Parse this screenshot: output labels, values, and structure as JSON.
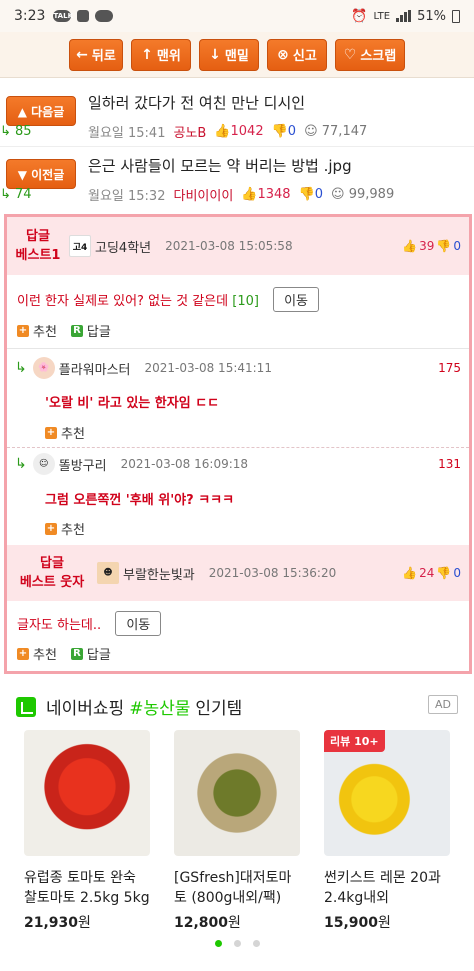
{
  "status": {
    "time": "3:23",
    "network": "LTE",
    "battery": "51%"
  },
  "toolbar": {
    "buttons": [
      {
        "icon": "←",
        "label": "뒤로"
      },
      {
        "icon": "↑",
        "label": "맨위"
      },
      {
        "icon": "↓",
        "label": "맨밑"
      },
      {
        "icon": "⊗",
        "label": "신고"
      },
      {
        "icon": "♡",
        "label": "스크랩"
      }
    ]
  },
  "nav": {
    "next": {
      "button": "▲ 다음글",
      "title": "일하러 갔다가 전 여친 만난 디시인",
      "date": "월요일 15:41",
      "author": "공노B",
      "up": "1042",
      "down": "0",
      "replies": "85",
      "views": "77,147"
    },
    "prev": {
      "button": "▼ 이전글",
      "title": "은근 사람들이 모르는 약 버리는 방법 .jpg",
      "date": "월요일 15:32",
      "author": "다비이이이",
      "up": "1348",
      "down": "0",
      "replies": "74",
      "views": "99,989"
    }
  },
  "comments": {
    "best1": {
      "badge_line1": "답글",
      "badge_line2": "베스트1",
      "avatar_text": "고4",
      "user": "고딩4학년",
      "date": "2021-03-08 15:05:58",
      "up": "39",
      "down": "0",
      "text": "이런 한자 실제로 있어? 없는 것 같은데",
      "count": "[10]",
      "move": "이동",
      "recommend": "추천",
      "reply": "답글"
    },
    "replies": [
      {
        "user": "플라워마스터",
        "date": "2021-03-08 15:41:11",
        "count": "175",
        "text": "'오랄 비' 라고 있는 한자임 ㄷㄷ",
        "recommend": "추천"
      },
      {
        "user": "똘방구리",
        "date": "2021-03-08 16:09:18",
        "count": "131",
        "text": "그럼 오른쪽껀 '후배 위'야? ㅋㅋㅋ",
        "recommend": "추천"
      }
    ],
    "best_funny": {
      "badge_line1": "답글",
      "badge_line2": "베스트 웃자",
      "user": "부랄한눈빛과",
      "date": "2021-03-08 15:36:20",
      "up": "24",
      "down": "0",
      "text": "글자도 하는데..",
      "move": "이동",
      "recommend": "추천",
      "reply": "답글"
    }
  },
  "shopping": {
    "title_prefix": "네이버쇼핑",
    "title_highlight": "#농산물",
    "title_suffix": "인기템",
    "ad": "AD",
    "products": [
      {
        "name": "유럽종 토마토 완숙 찰토마토 2.5kg 5kg",
        "price": "21,930",
        "unit": "원",
        "badge": ""
      },
      {
        "name": "[GSfresh]대저토마토 (800g내외/팩)",
        "price": "12,800",
        "unit": "원",
        "badge": ""
      },
      {
        "name": "썬키스트 레몬 20과 2.4kg내외",
        "price": "15,900",
        "unit": "원",
        "badge": "리뷰 10+"
      }
    ]
  }
}
